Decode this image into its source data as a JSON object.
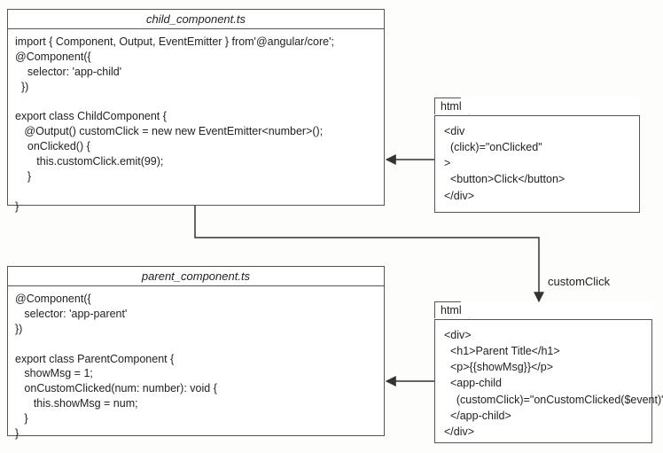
{
  "boxes": {
    "child": {
      "title": "child_component.ts",
      "code": "import { Component, Output, EventEmitter } from'@angular/core';\n@Component({\n    selector: 'app-child'\n  })\n\nexport class ChildComponent {\n   @Output() customClick = new new EventEmitter<number>();\n    onClicked() {\n       this.customClick.emit(99);\n    }\n\n}"
    },
    "parent": {
      "title": "parent_component.ts",
      "code": "@Component({\n   selector: 'app-parent'\n})\n\nexport class ParentComponent {\n   showMsg = 1;\n   onCustomClicked(num: number): void {\n      this.showMsg = num;\n   }\n}"
    }
  },
  "notes": {
    "childHtml": {
      "tab": "html",
      "code": "<div\n  (click)=\"onClicked\"\n>\n  <button>Click</button>\n</div>"
    },
    "parentHtml": {
      "tab": "html",
      "code": "<div>\n  <h1>Parent Title</h1>\n  <p>{{showMsg}}</p>\n  <app-child\n    (customClick)=\"onCustomClicked($event)\"\n  </app-child>\n</div>"
    }
  },
  "edges": {
    "customClick": "customClick"
  }
}
